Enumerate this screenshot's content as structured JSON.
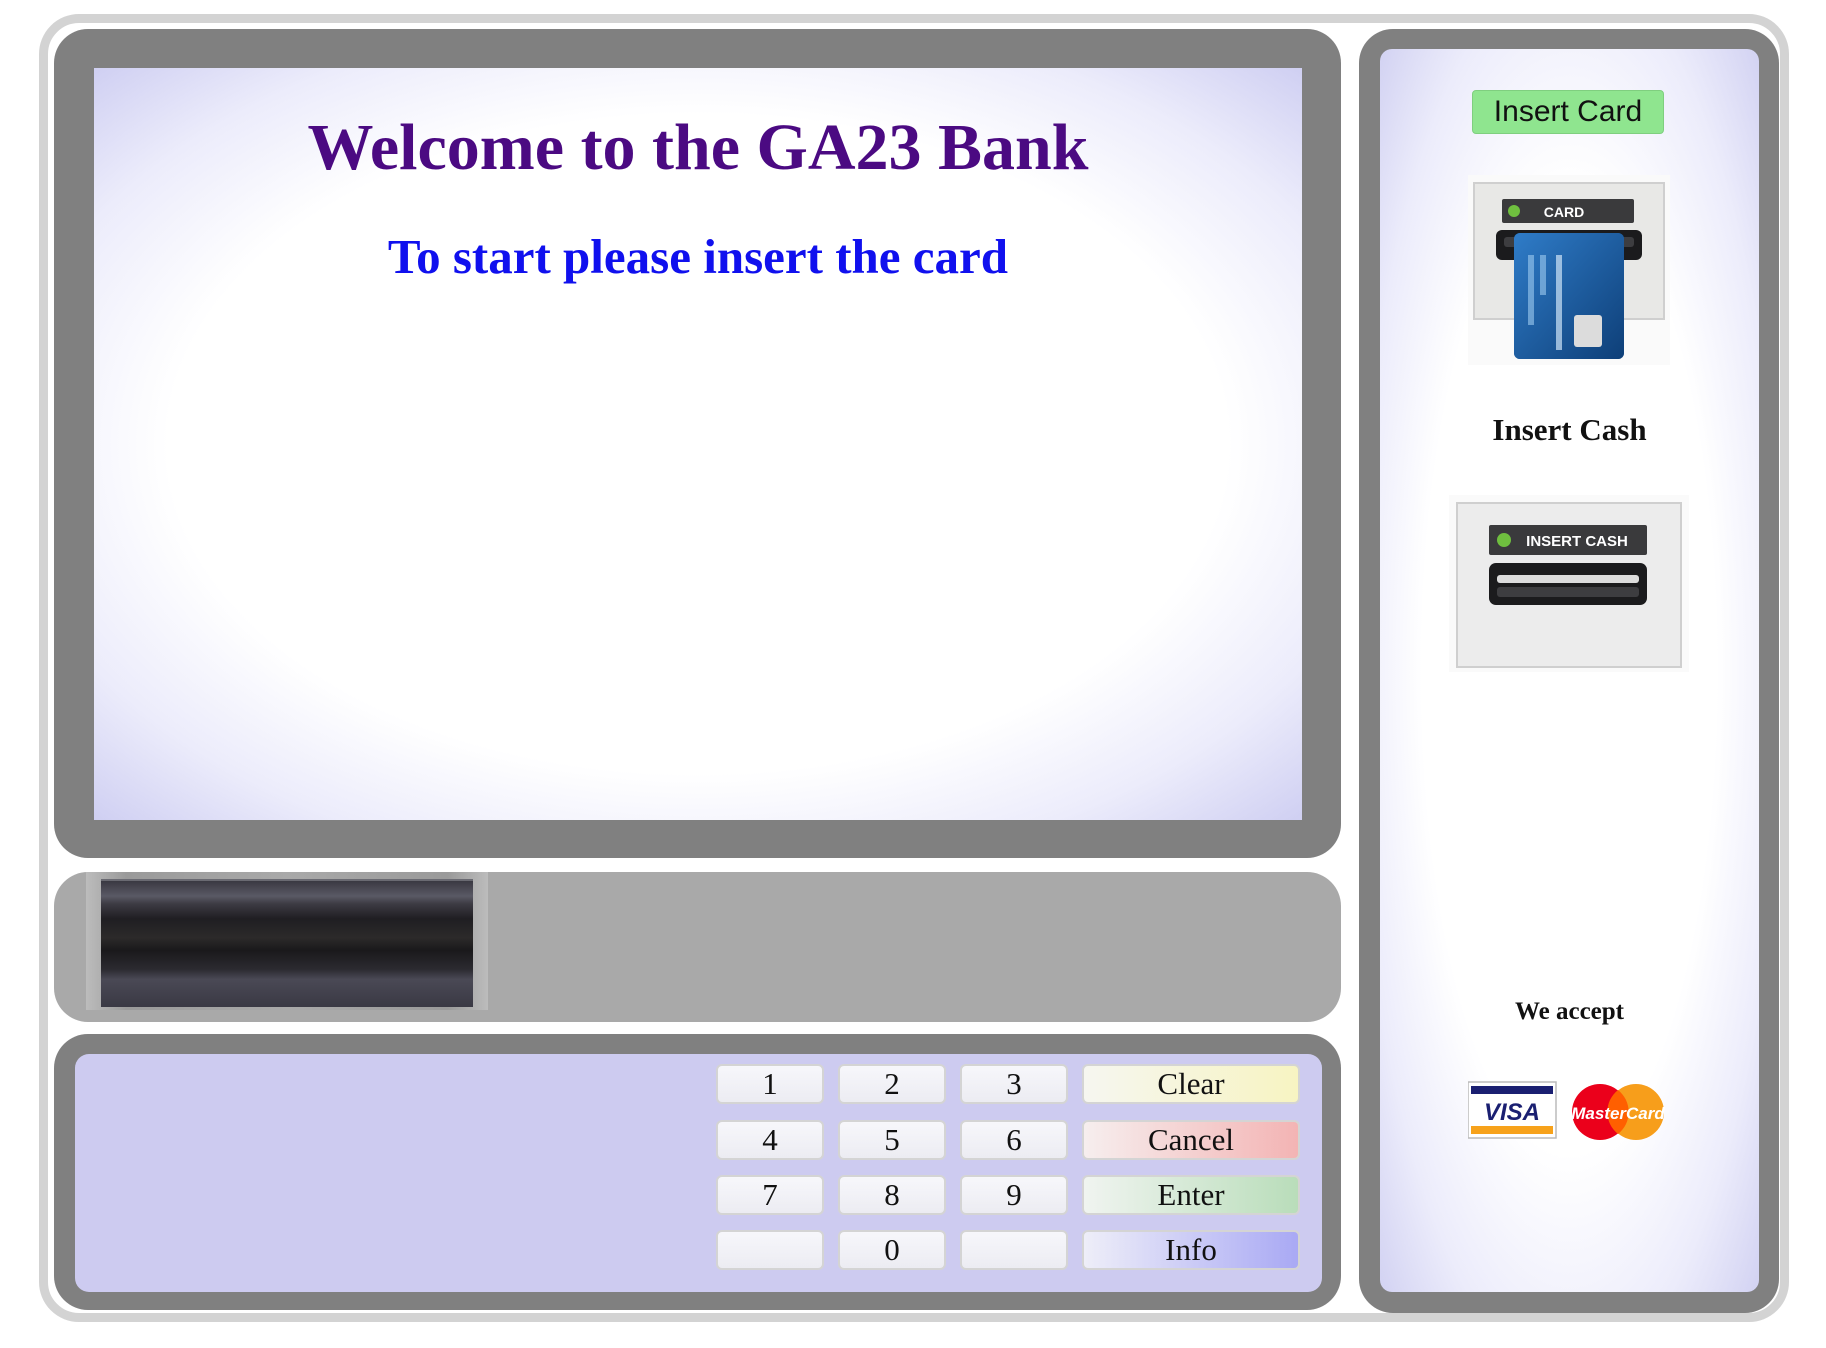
{
  "screen": {
    "title": "Welcome to the GA23 Bank",
    "subtitle": "To start please insert the card"
  },
  "keypad": {
    "keys": [
      "1",
      "2",
      "3",
      "4",
      "5",
      "6",
      "7",
      "8",
      "9",
      "",
      "0",
      ""
    ],
    "clear": "Clear",
    "cancel": "Cancel",
    "enter": "Enter",
    "info": "Info"
  },
  "side": {
    "insert_card_button": "Insert Card",
    "card_slot_label": "CARD",
    "insert_cash_label": "Insert Cash",
    "cash_slot_label": "INSERT CASH",
    "accept_label": "We accept",
    "card_brands": [
      "VISA",
      "MasterCard"
    ]
  },
  "colors": {
    "title": "#4b0a82",
    "subtitle": "#1010ee",
    "insert_card_button": "#8fe58f",
    "keypad_panel": "#cdcbf0"
  }
}
